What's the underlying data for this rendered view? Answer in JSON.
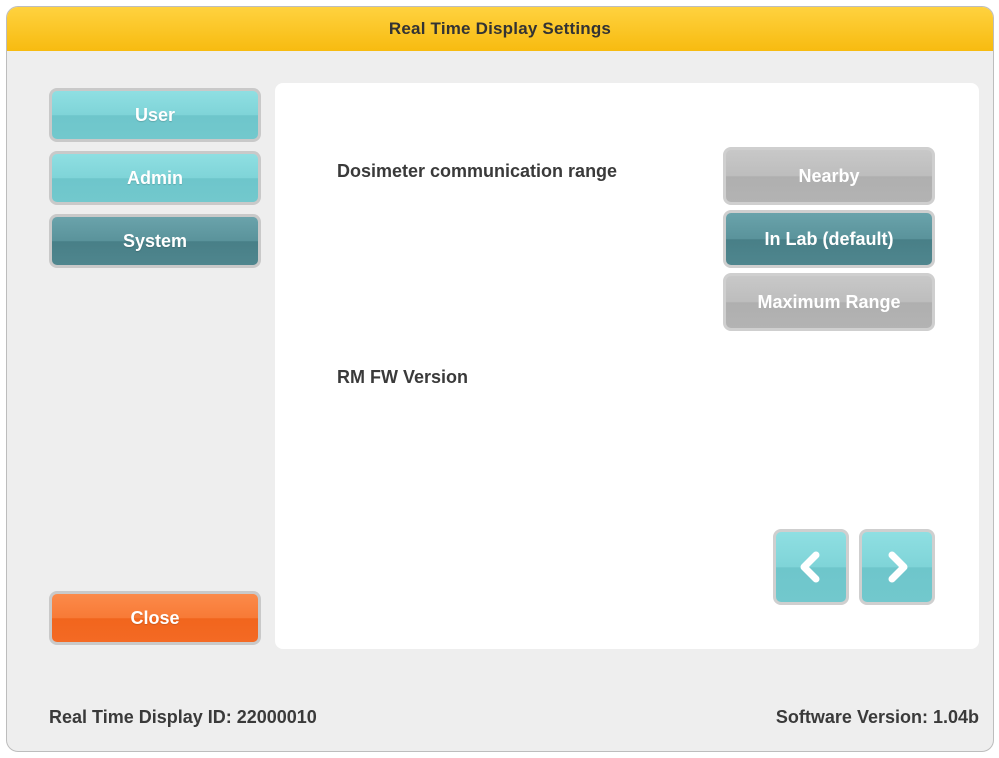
{
  "window": {
    "title": "Real Time Display Settings"
  },
  "sidebar": {
    "items": [
      {
        "label": "User"
      },
      {
        "label": "Admin"
      },
      {
        "label": "System"
      }
    ],
    "close_label": "Close"
  },
  "main": {
    "comm_range_label": "Dosimeter communication range",
    "options": [
      {
        "label": "Nearby",
        "selected": false
      },
      {
        "label": "In Lab (default)",
        "selected": true
      },
      {
        "label": "Maximum Range",
        "selected": false
      }
    ],
    "fw_version_label": "RM FW Version",
    "prev_icon": "chevron-left-icon",
    "next_icon": "chevron-right-icon"
  },
  "footer": {
    "display_id": "Real Time Display ID: 22000010",
    "software_version": "Software Version: 1.04b"
  },
  "colors": {
    "title_bar": "#f7bb10",
    "teal_light": "#7fd4d8",
    "teal_dark": "#5a939b",
    "close_orange": "#f87a36",
    "option_gray": "#bdbdbd"
  }
}
